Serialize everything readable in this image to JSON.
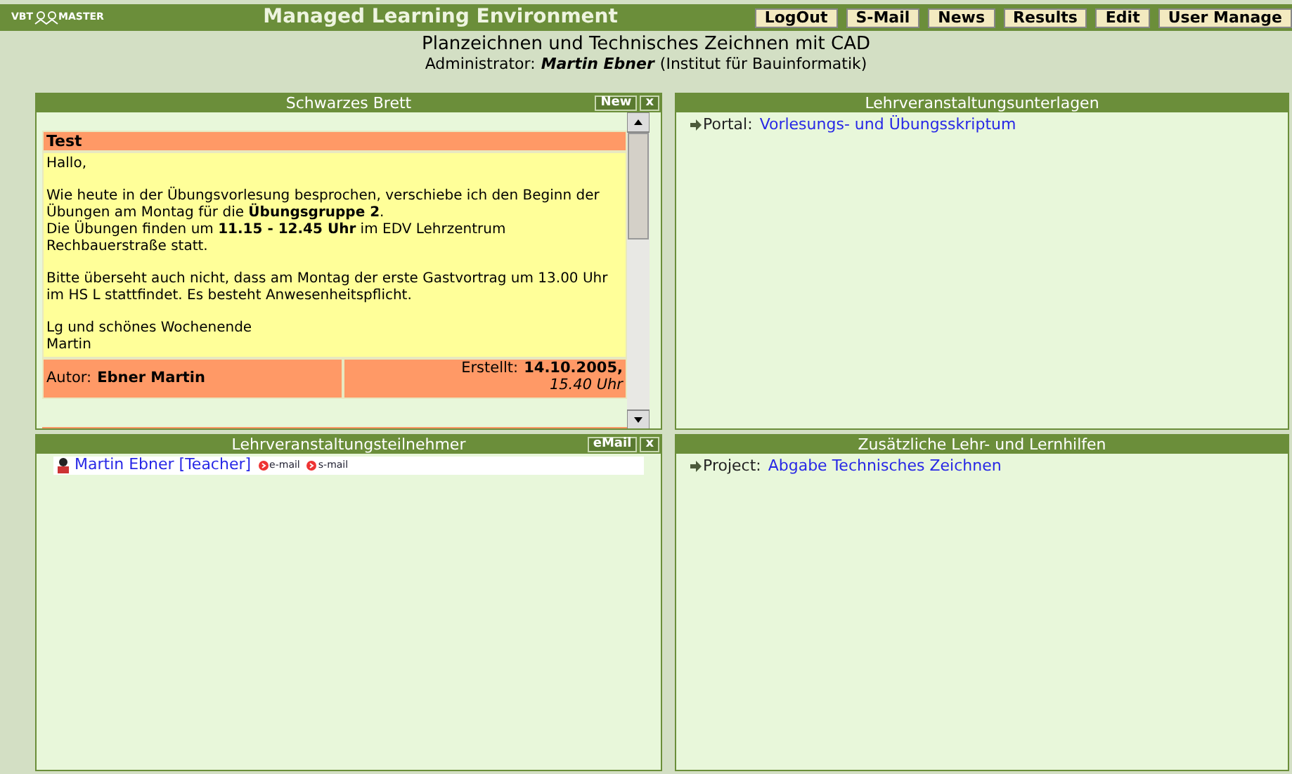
{
  "header": {
    "logo": [
      "VBT",
      "MASTER"
    ],
    "title": "Managed Learning Environment",
    "buttons": [
      "LogOut",
      "S-Mail",
      "News",
      "Results",
      "Edit",
      "User Manage"
    ]
  },
  "course": {
    "title": "Planzeichnen und Technisches Zeichnen mit CAD",
    "admin_label": "Administrator:",
    "admin_name": "Martin Ebner",
    "institute": "(Institut für Bauinformatik)"
  },
  "board": {
    "title": "Schwarzes Brett",
    "buttons": [
      "New",
      "x"
    ],
    "posts": [
      {
        "title": "Test",
        "paragraphs": [
          "Hallo,",
          "Wie heute in der Übungsvorlesung besprochen, verschiebe ich den Beginn der Übungen am Montag für die **Übungsgruppe 2**.\nDie Übungen finden um **11.15 - 12.45 Uhr** im EDV Lehrzentrum Rechbauerstraße statt.",
          "Bitte überseht auch nicht, dass am Montag der erste Gastvortrag um 13.00 Uhr im HS L stattfindet. Es besteht Anwesenheitspflicht.",
          "Lg und schönes Wochenende\nMartin"
        ],
        "author_label": "Autor:",
        "author": "Ebner Martin",
        "created_label": "Erstellt:",
        "date": "14.10.2005,",
        "time": "15.40 Uhr"
      }
    ]
  },
  "materials": {
    "title": "Lehrveranstaltungsunterlagen",
    "items": [
      {
        "label": "Portal:",
        "link": "Vorlesungs- und Übungsskriptum"
      }
    ]
  },
  "participants": {
    "title": "Lehrveranstaltungsteilnehmer",
    "buttons": [
      "eMail",
      "x"
    ],
    "members": [
      {
        "name": "Martin Ebner [Teacher]",
        "links": [
          "e-mail",
          "s-mail"
        ]
      }
    ]
  },
  "aids": {
    "title": "Zusätzliche Lehr- und Lernhilfen",
    "items": [
      {
        "label": "Project:",
        "link": "Abgabe Technisches Zeichnen"
      }
    ]
  }
}
